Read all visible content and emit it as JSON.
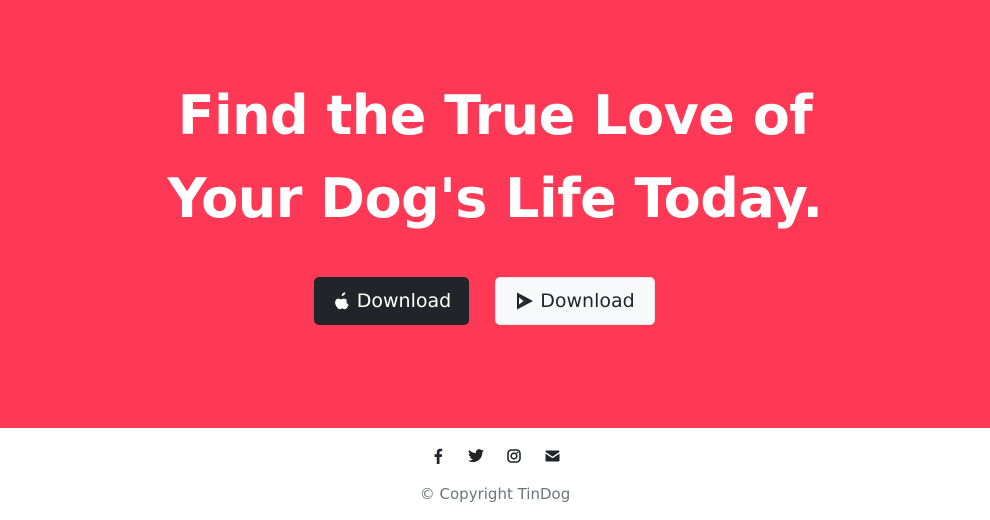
{
  "hero": {
    "background": "#ff3856",
    "headline_line1": "Find the True Love of",
    "headline_line2": "Your Dog's Life Today.",
    "buttons": [
      {
        "label": "Download",
        "icon": "apple-icon",
        "style": "dark"
      },
      {
        "label": "Download",
        "icon": "google-play-icon",
        "style": "light"
      }
    ]
  },
  "footer": {
    "social_icons": [
      "facebook-icon",
      "twitter-icon",
      "instagram-icon",
      "envelope-icon"
    ],
    "copyright": "© Copyright TinDog"
  }
}
